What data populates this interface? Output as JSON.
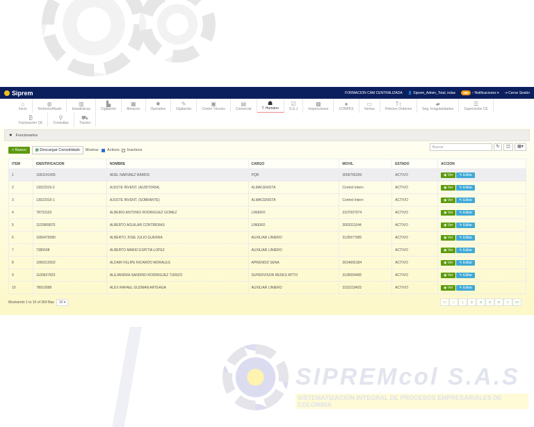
{
  "navbar": {
    "brand": "Siprem",
    "company": "FORMACION CAM CENTRALIZADA",
    "user": "Siprem_Admin_Total, indaz",
    "notif_count": "385",
    "notifications": "Notificaciones",
    "logout": "Cerrar Sesión"
  },
  "menu": [
    {
      "label": "Inicio",
      "icon": "home-icon",
      "glyph": "⌂"
    },
    {
      "label": "Territorio/Aliado",
      "icon": "globe-icon",
      "glyph": "◍"
    },
    {
      "label": "Estadisticas",
      "icon": "chart-icon",
      "glyph": "▥"
    },
    {
      "label": "Digitación",
      "icon": "document-icon",
      "glyph": "▙"
    },
    {
      "label": "Almacen",
      "icon": "cart-icon",
      "glyph": "▦"
    },
    {
      "label": "Operativo",
      "icon": "gear-icon",
      "glyph": "✹"
    },
    {
      "label": "Digitación",
      "icon": "pencil-icon",
      "glyph": "✎"
    },
    {
      "label": "Centro Técnico",
      "icon": "phone-icon",
      "glyph": "▣"
    },
    {
      "label": "Comercial",
      "icon": "briefcase-icon",
      "glyph": "▤"
    },
    {
      "label": "T. Humano",
      "icon": "users-icon",
      "glyph": "☗",
      "active": true
    },
    {
      "label": "S.G.J",
      "icon": "check-icon",
      "glyph": "☑"
    },
    {
      "label": "Inspecciones",
      "icon": "archive-icon",
      "glyph": "▩"
    },
    {
      "label": "CONPES",
      "icon": "leaf-icon",
      "glyph": "♠"
    },
    {
      "label": "Ventas",
      "icon": "money-icon",
      "glyph": "▭"
    },
    {
      "label": "Peticion Ordenes",
      "icon": "sort-icon",
      "glyph": "T↕"
    },
    {
      "label": "Seg. Irregularidades",
      "icon": "folder-icon",
      "glyph": "▰"
    },
    {
      "label": "Supervisión CE",
      "icon": "list-icon",
      "glyph": "☰"
    },
    {
      "label": "Facturacion CE",
      "icon": "bitcoin-icon",
      "glyph": "₿"
    },
    {
      "label": "Consultas",
      "icon": "search-icon",
      "glyph": "⚲"
    },
    {
      "label": "Tracker",
      "icon": "truck-icon",
      "glyph": "⛟"
    }
  ],
  "panel": {
    "title": "Funcionarios"
  },
  "toolbar": {
    "new": "+ Nuevo",
    "download": "Descargar Consolidado",
    "show": "Mostrar:",
    "active": "Activos",
    "inactive": "Inactivos",
    "search_placeholder": "Buscar"
  },
  "table": {
    "headers": [
      "ITEM",
      "IDENTIFICACION",
      "NOMBRE",
      "CARGO",
      "MOVIL",
      "ESTADO",
      "ACCION"
    ],
    "view": "Ver",
    "edit": "Editar",
    "rows": [
      [
        "1",
        "1063141435",
        "ADEL NARVAEZ RAMOS",
        "PQR",
        "3006766299",
        "ACTIVO"
      ],
      [
        "2",
        "13022019-2",
        "AJUSTE INVENT. (AUDITORIA)",
        "ALMACENISTA",
        "Control Intern",
        "ACTIVO"
      ],
      [
        "3",
        "13022019-1",
        "AJUSTE INVENT. (SOBRANTE)",
        "ALMACENISTA",
        "Control Intern",
        "ACTIVO"
      ],
      [
        "4",
        "78733103",
        "ALBEIRO ANTONIO RODRIGUEZ GOMEZ",
        "LINIERO",
        "3107007974",
        "ACTIVO"
      ],
      [
        "5",
        "1102809875",
        "ALBERTO AGUILAR CONTRERAS",
        "LINIERO",
        "3003311044",
        "ACTIVO"
      ],
      [
        "6",
        "1069475580",
        "ALBERTO JOSE JULIO GUERRA",
        "AUXILIAR LINIERO",
        "3135977085",
        "ACTIVO"
      ],
      [
        "7",
        "7385508",
        "ALBERTO MARIO ESPITIA LOPEZ",
        "AUXILIAR LINIERO",
        "",
        "ACTIVO"
      ],
      [
        "8",
        "1065012602",
        "ALDAIR FELIPE RICARDO MORALES",
        "APRENDIZ SENA",
        "3014665184",
        "ACTIVO"
      ],
      [
        "9",
        "1100627823",
        "ALEJANDRA SANDRID RODRIGUEZ TURIZO",
        "SUPERVISOR REDES MTTO",
        "3135554495",
        "ACTIVO"
      ],
      [
        "10",
        "78010098",
        "ALEX RAFAEL GUZMAN ARTEAGA",
        "AUXILIAR LINIERO",
        "3152218425",
        "ACTIVO"
      ]
    ]
  },
  "footer": {
    "showing": "Mostrando 1 to 10 of 369 filas",
    "page_size": "10 ▾",
    "pages": [
      "<<",
      "<",
      "1",
      "2",
      "3",
      "4",
      "5",
      ">",
      ">>"
    ]
  },
  "watermark": {
    "logo": "SIPREMcol S.A.S",
    "slogan": "SISTEMATIZACIÓN INTEGRAL DE PROCESOS EMPRESARIALES DE COLOMBIA"
  }
}
